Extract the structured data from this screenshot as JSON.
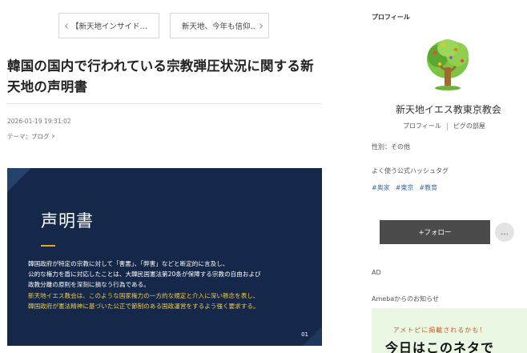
{
  "nav": {
    "prev_label": "【新天地インサイド…",
    "next_label": "新天地、今年も信仰…"
  },
  "article": {
    "title": "韓国の国内で行われている宗教弾圧状況に関する新天地の声明書",
    "date": "2026-01-19 19:31:02",
    "theme": "テーマ：ブログ"
  },
  "statement_image": {
    "heading": "声明書",
    "lines": [
      "韓国政府が特定の宗教に対して「害悪」、「弊害」などと断定的に言及し、",
      "公的な権力を盾に対応したことは、大韓民国憲法第20条が保障する宗教の自由および",
      "政教分離の原則を深刻に損なう行為である。",
      "新天地イエス教会は、このような国家権力の一方的な規定と介入に深い懸念を表し、",
      "韓国政府が憲法精神に基づいた公正で節制のある国政運営をするよう強く要求する。"
    ],
    "page_number": "01",
    "colors": {
      "background": "#16284a",
      "accent": "#e8a42a",
      "highlight": "#f1c94a"
    }
  },
  "sidebar": {
    "heading": "プロフィール",
    "blog_name": "新天地イエス教東京教会",
    "links": [
      "プロフィール",
      "ピグの部屋"
    ],
    "gender": "性別：その他",
    "hashtag_heading": "よく使う公式ハッシュタグ",
    "hashtags": [
      "#奥家",
      "#東京",
      "#教育"
    ],
    "follow_label": "+フォロー",
    "more_label": "…",
    "ad_label": "AD",
    "ameba_label": "Amebaからのお知らせ",
    "promo_sub": "アメトピに掲載されるかも！",
    "promo_main": "今日はこのネタで"
  }
}
